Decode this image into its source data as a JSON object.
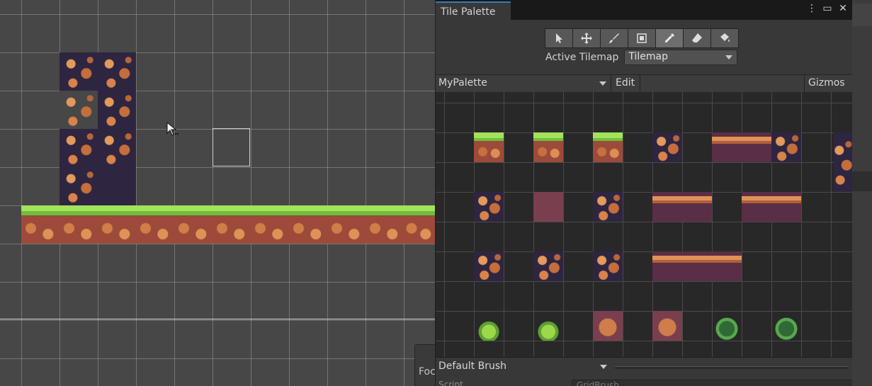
{
  "tile_palette": {
    "tab_title": "Tile Palette",
    "window_buttons": [
      "⋮",
      "▭",
      "✕"
    ],
    "tools": [
      {
        "name": "select-tool",
        "icon": "arrow-icon",
        "active": false
      },
      {
        "name": "move-tool",
        "icon": "move-icon",
        "active": false
      },
      {
        "name": "paint-tool",
        "icon": "brush-icon",
        "active": false
      },
      {
        "name": "box-fill-tool",
        "icon": "box-icon",
        "active": false
      },
      {
        "name": "picker-tool",
        "icon": "eyedropper-icon",
        "active": true
      },
      {
        "name": "erase-tool",
        "icon": "eraser-icon",
        "active": false
      },
      {
        "name": "fill-tool",
        "icon": "bucket-icon",
        "active": false
      }
    ],
    "active_tilemap_label": "Active Tilemap",
    "active_tilemap_value": "Tilemap",
    "palette_name": "MyPalette",
    "edit_label": "Edit",
    "gizmos_label": "Gizmos",
    "brush_name": "Default Brush",
    "script_label": "Script",
    "script_value": "GridBrush"
  },
  "scene": {
    "focus_label": "Foc"
  },
  "colors": {
    "accent": "#3a79bb",
    "grass": "#a3e25a",
    "rock": "#d9824a",
    "dark_bg": "#2e2540"
  }
}
